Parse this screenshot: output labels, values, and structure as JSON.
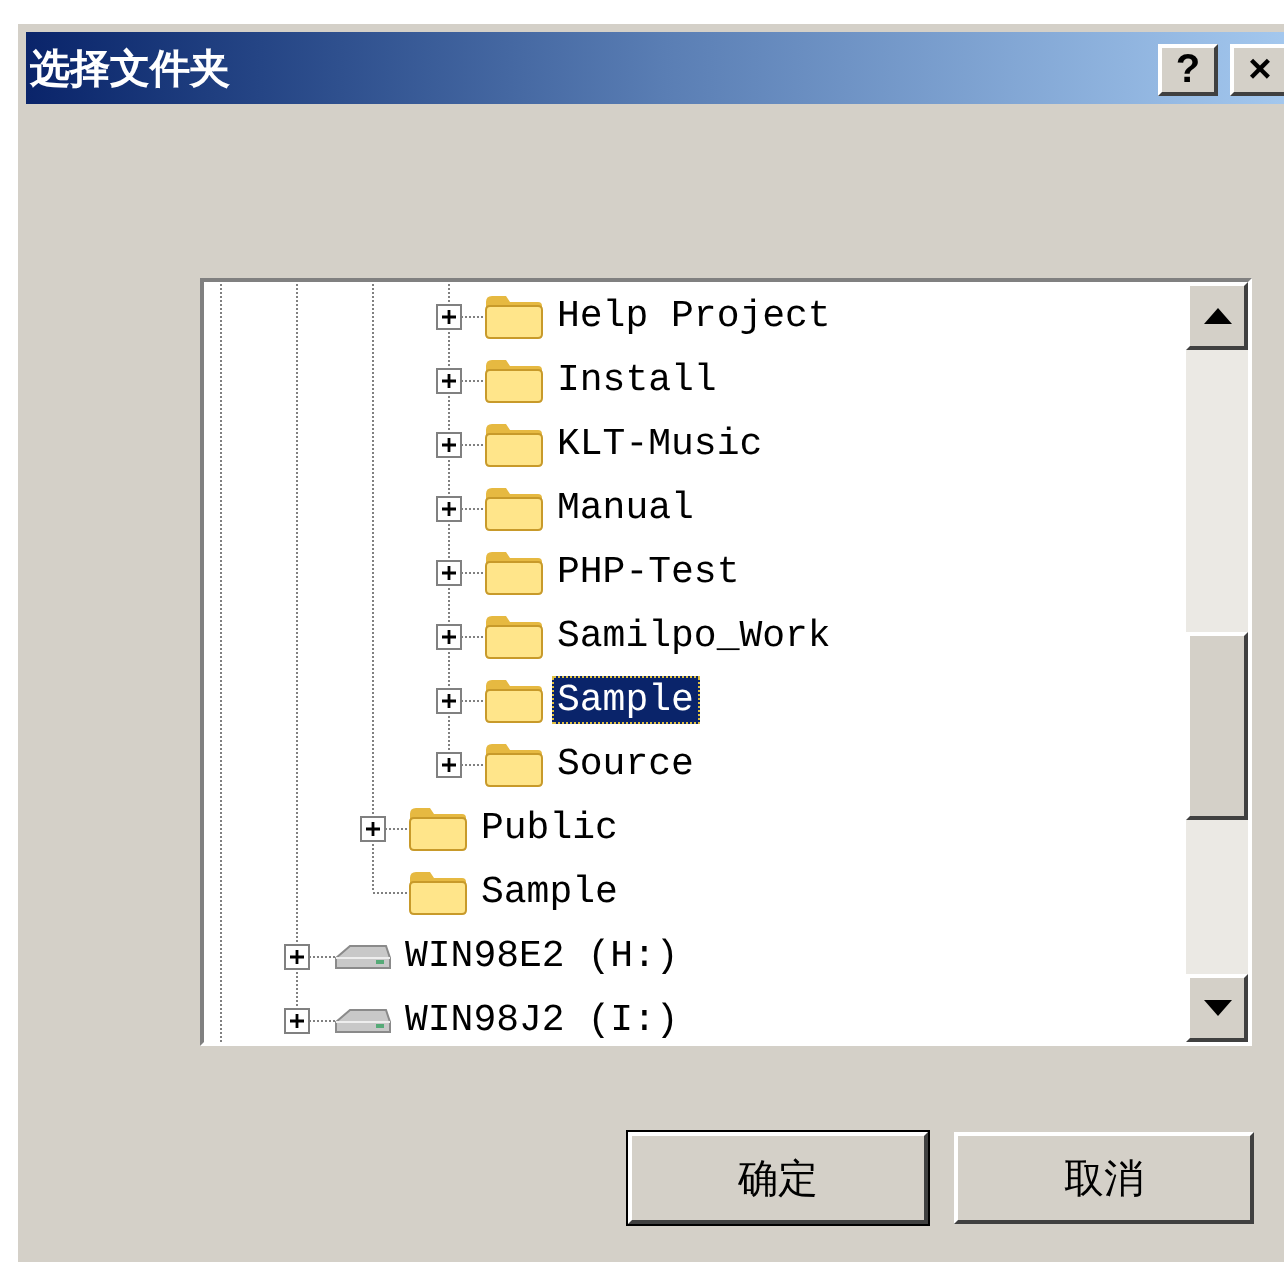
{
  "window": {
    "title": "选择文件夹",
    "title_buttons": [
      "?",
      "×"
    ]
  },
  "tree": {
    "items": [
      {
        "children": [
          {
            "children": [
              {
                "label": "Help Project",
                "kind": "folder",
                "expandable": true,
                "selected": false
              },
              {
                "label": "Install",
                "kind": "folder",
                "expandable": true,
                "selected": false
              },
              {
                "label": "KLT-Music",
                "kind": "folder",
                "expandable": true,
                "selected": false
              },
              {
                "label": "Manual",
                "kind": "folder",
                "expandable": true,
                "selected": false
              },
              {
                "label": "PHP-Test",
                "kind": "folder",
                "expandable": true,
                "selected": false
              },
              {
                "label": "Samilpo_Work",
                "kind": "folder",
                "expandable": true,
                "selected": false
              },
              {
                "label": "Sample",
                "kind": "folder",
                "expandable": true,
                "selected": true
              },
              {
                "label": "Source",
                "kind": "folder",
                "expandable": true,
                "selected": false
              }
            ]
          },
          {
            "label": "Public",
            "kind": "folder",
            "expandable": true,
            "selected": false
          },
          {
            "label": "Sample",
            "kind": "folder",
            "expandable": false,
            "selected": false
          }
        ]
      },
      {
        "label": "WIN98E2 (H:)",
        "kind": "drive",
        "expandable": true,
        "selected": false
      },
      {
        "label": "WIN98J2 (I:)",
        "kind": "drive",
        "expandable": true,
        "selected": false
      }
    ]
  },
  "buttons": [
    {
      "label": "确定",
      "default": true
    },
    {
      "label": "取消",
      "default": false
    }
  ]
}
